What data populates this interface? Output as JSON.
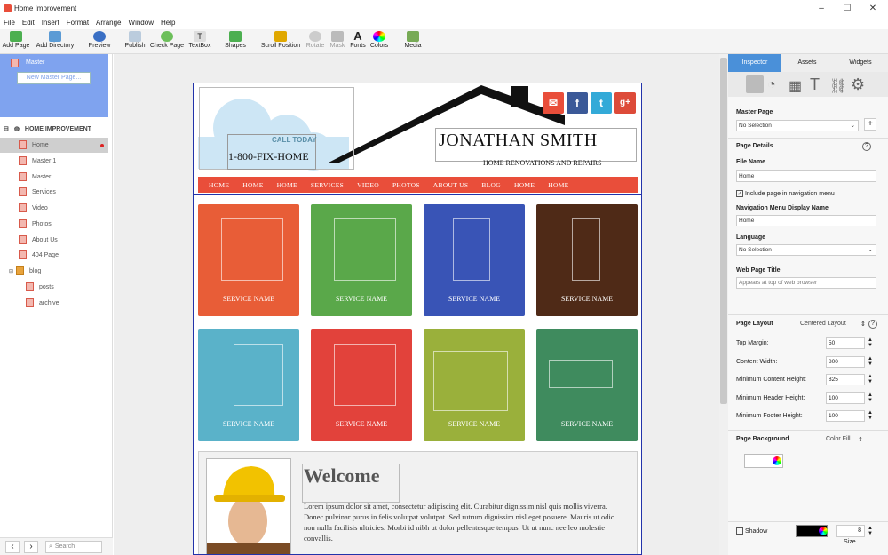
{
  "app": {
    "title": "Home Improvement"
  },
  "menu": [
    "File",
    "Edit",
    "Insert",
    "Format",
    "Arrange",
    "Window",
    "Help"
  ],
  "toolbar": {
    "add_page": "Add Page",
    "add_directory": "Add Directory",
    "preview": "Preview",
    "publish": "Publish",
    "check_page": "Check Page",
    "textbox": "TextBox",
    "shapes": "Shapes",
    "scroll_position": "Scroll Position",
    "rotate": "Rotate",
    "mask": "Mask",
    "fonts": "Fonts",
    "colors": "Colors",
    "media": "Media"
  },
  "left": {
    "master_label": "Master",
    "new_master_page": "New Master Page...",
    "site_title": "HOME IMPROVEMENT",
    "pages": [
      "Home",
      "Master 1",
      "Master",
      "Services",
      "Video",
      "Photos",
      "About Us",
      "404 Page",
      "blog",
      "posts",
      "archive"
    ],
    "search_placeholder": "Search"
  },
  "site": {
    "call_today": "CALL TODAY",
    "phone": "1-800-FIX-HOME",
    "name": "JONATHAN SMITH",
    "tagline": "HOME RENOVATIONS AND REPAIRS",
    "nav": [
      "HOME",
      "HOME",
      "HOME",
      "SERVICES",
      "VIDEO",
      "PHOTOS",
      "ABOUT US",
      "BLOG",
      "HOME",
      "HOME"
    ],
    "tiles": [
      {
        "label": "SERVICE NAME",
        "color": "#e85d37"
      },
      {
        "label": "SERVICE NAME",
        "color": "#5aa84a"
      },
      {
        "label": "SERVICE NAME",
        "color": "#3954b6"
      },
      {
        "label": "SERVICE NAME",
        "color": "#4f2a17"
      },
      {
        "label": "SERVICE NAME",
        "color": "#5ab2c9"
      },
      {
        "label": "SERVICE NAME",
        "color": "#e2423b"
      },
      {
        "label": "SERVICE NAME",
        "color": "#9ab03b"
      },
      {
        "label": "SERVICE NAME",
        "color": "#3f8b5e"
      }
    ],
    "welcome_heading": "Welcome",
    "welcome_text": "Lorem ipsum dolor sit amet, consectetur adipiscing elit. Curabitur dignissim nisl quis mollis viverra. Donec pulvinar purus in felis volutpat volutpat. Sed rutrum dignissim nisl eget posuere. Mauris ut odio non nulla facilisis ultricies. Morbi id nibh ut dolor pellentesque tempus. Ut ut nunc nee leo molestie convallis.",
    "social": {
      "email": "✉",
      "facebook": "f",
      "twitter": "t",
      "google": "g+"
    }
  },
  "inspector": {
    "tabs": [
      "Inspector",
      "Assets",
      "Widgets"
    ],
    "master_page_label": "Master Page",
    "master_page_value": "No Selection",
    "page_details": "Page Details",
    "file_name_label": "File Name",
    "file_name_value": "Home",
    "include_nav": "Include page in navigation menu",
    "nav_display_label": "Navigation Menu Display Name",
    "nav_display_value": "Home",
    "language_label": "Language",
    "language_value": "No Selection",
    "web_title_label": "Web Page Title",
    "web_title_placeholder": "Appears at top of web browser",
    "page_layout": "Page Layout",
    "layout_mode": "Centered Layout",
    "top_margin_label": "Top Margin:",
    "top_margin": "50",
    "content_width_label": "Content Width:",
    "content_width": "800",
    "min_content_label": "Minimum Content Height:",
    "min_content": "825",
    "min_header_label": "Minimum Header Height:",
    "min_header": "100",
    "min_footer_label": "Minimum Footer Height:",
    "min_footer": "100",
    "page_background": "Page Background",
    "color_fill": "Color Fill",
    "shadow_label": "Shadow",
    "size_value": "8",
    "size_label": "Size"
  },
  "colors": {
    "accent": "#e94e3a",
    "master_bg": "#7fa3ef",
    "inspector_tab": "#4a90d9"
  }
}
